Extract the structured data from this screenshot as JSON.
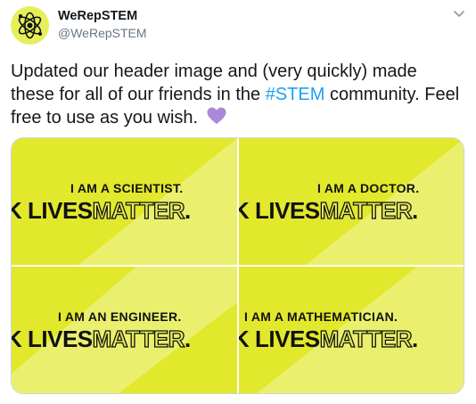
{
  "account": {
    "display_name": "WeRepSTEM",
    "handle": "@WeRepSTEM"
  },
  "tweet": {
    "text_part1": "Updated our header image and (very quickly) made these for all of our friends in the ",
    "hashtag": "#STEM",
    "text_part2": " community. Feel free to use as you wish.",
    "emoji": "purple-heart-icon"
  },
  "media": {
    "tiles": [
      {
        "role": "I AM A SCIENTIST.",
        "slogan_solid": "K LIVES",
        "slogan_outline": "MATTER",
        "slogan_end": "."
      },
      {
        "role": "I AM A DOCTOR.",
        "slogan_solid": "K LIVES",
        "slogan_outline": "MATTER",
        "slogan_end": "."
      },
      {
        "role": "I AM AN ENGINEER.",
        "slogan_solid": "K LIVES",
        "slogan_outline": "MATTER",
        "slogan_end": "."
      },
      {
        "role": "I AM A MATHEMATICIAN.",
        "slogan_solid": "K LIVES",
        "slogan_outline": "MATTER",
        "slogan_end": "."
      }
    ]
  },
  "colors": {
    "tile_yellow": "#e6ef5a",
    "tile_yellow_dark": "#e2e82c",
    "link_blue": "#1da1f2",
    "heart_purple": "#a98ad9"
  }
}
